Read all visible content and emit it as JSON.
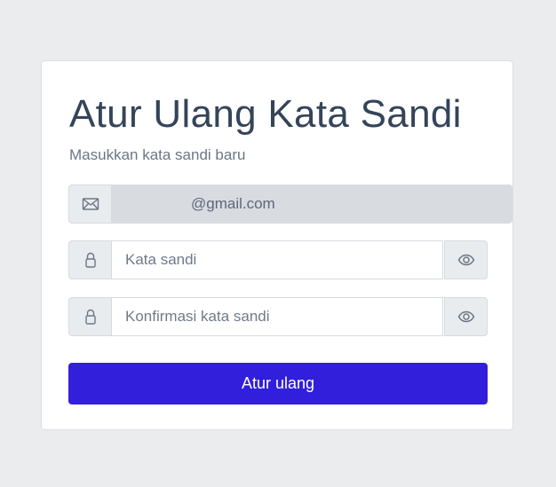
{
  "form": {
    "title": "Atur Ulang Kata Sandi",
    "subtitle": "Masukkan kata sandi baru",
    "email_value": "@gmail.com",
    "password_placeholder": "Kata sandi",
    "confirm_placeholder": "Konfirmasi kata sandi",
    "submit_label": "Atur ulang",
    "icons": {
      "email": "envelope-icon",
      "password": "lock-icon",
      "toggle": "eye-icon"
    },
    "colors": {
      "background": "#ebecee",
      "primary": "#321fdb",
      "title": "#354458"
    }
  }
}
